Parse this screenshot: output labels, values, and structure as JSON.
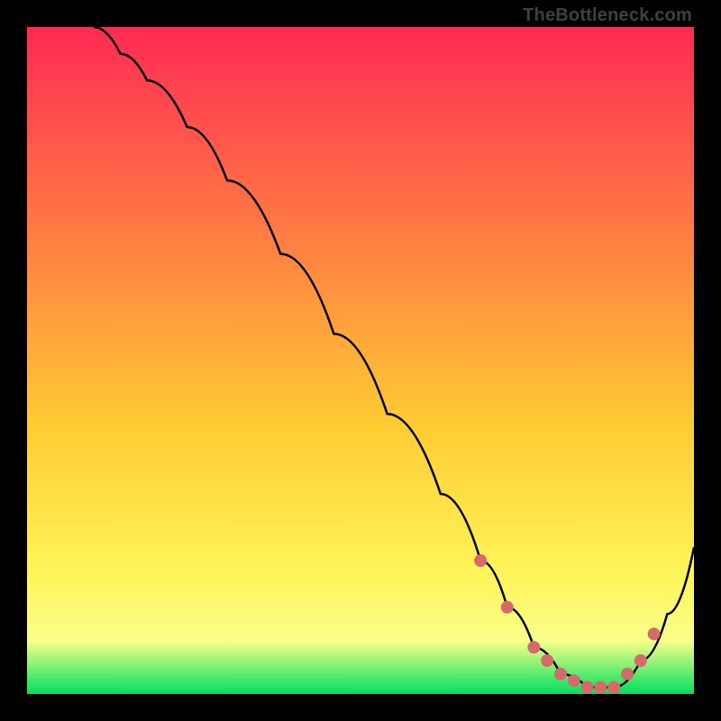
{
  "attribution": "TheBottleneck.com",
  "colors": {
    "frame": "#000000",
    "gradient_top": "#ff2a55",
    "gradient_bottom": "#00e060",
    "curve": "#000000",
    "dots": "#d66a6a"
  },
  "chart_data": {
    "type": "line",
    "title": "",
    "xlabel": "",
    "ylabel": "",
    "xlim": [
      0,
      100
    ],
    "ylim": [
      0,
      100
    ],
    "series": [
      {
        "name": "bottleneck-curve",
        "x": [
          10,
          14,
          18,
          24,
          30,
          38,
          46,
          54,
          62,
          68,
          72,
          76,
          80,
          84,
          88,
          92,
          96,
          100
        ],
        "y": [
          100,
          96,
          92,
          85,
          77,
          66,
          54,
          42,
          30,
          20,
          13,
          7,
          3,
          1,
          1,
          5,
          12,
          22
        ]
      }
    ],
    "highlight_points": {
      "name": "sweet-spot-dots",
      "x": [
        68,
        72,
        76,
        78,
        80,
        82,
        84,
        86,
        88,
        90,
        92,
        94
      ],
      "y": [
        20,
        13,
        7,
        5,
        3,
        2,
        1,
        1,
        1,
        3,
        5,
        9
      ]
    }
  }
}
